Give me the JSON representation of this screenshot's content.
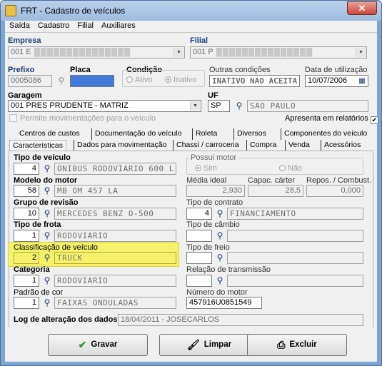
{
  "window": {
    "title": "FRT - Cadastro de veículos",
    "close": "✕"
  },
  "menu": [
    "Saída",
    "Cadastro",
    "Filial",
    "Auxiliares"
  ],
  "header": {
    "empresa_label": "Empresa",
    "empresa_value": "001 E",
    "filial_label": "Filial",
    "filial_value": "001 P",
    "prefixo_label": "Prefixo",
    "prefixo_value": "0005086",
    "placa_label": "Placa",
    "placa_value": "",
    "condicao_label": "Condição",
    "ativo": "Ativo",
    "inativo": "Inativo",
    "outras_label": "Outras condições",
    "outras_value": "INATIVO NAO ACEITA N",
    "data_label": "Data de utilização",
    "data_value": "10/07/2006",
    "garagem_label": "Garagem",
    "garagem_value": "001 PRES PRUDENTE - MATRIZ",
    "uf_label": "UF",
    "uf_value": "SP",
    "uf_city": "SAO PAULO",
    "permite_label": "Permite movimentações para o veículo",
    "apresenta_label": "Apresenta em relatórios"
  },
  "tabs_row1": [
    "Centros de custos",
    "Documentação do veículo",
    "Roleta",
    "Diversos",
    "Componentes do veículo"
  ],
  "tabs_row2": [
    "Características",
    "Dados para movimentação",
    "Chassi / carroceria",
    "Compra",
    "Venda",
    "Acessórios"
  ],
  "fields": {
    "tipo_veiculo_label": "Tipo de veículo",
    "tipo_veiculo_code": "4",
    "tipo_veiculo_desc": "ONIBUS RODOVIARIO 600 L",
    "possui_motor_label": "Possui motor",
    "sim": "Sim",
    "nao": "Não",
    "modelo_motor_label": "Modelo do motor",
    "modelo_motor_code": "58",
    "modelo_motor_desc": "MB OM 457 LA",
    "media_label": "Média ideal",
    "media_value": "2,930",
    "capac_label": "Capac. cárter",
    "capac_value": "28,5",
    "repos_label": "Repos. / Combust.",
    "repos_value": "0,000",
    "grupo_label": "Grupo de revisão",
    "grupo_code": "10",
    "grupo_desc": "MERCEDES BENZ O-500",
    "contrato_label": "Tipo de contrato",
    "contrato_code": "4",
    "contrato_desc": "FINANCIAMENTO",
    "frota_label": "Tipo de frota",
    "frota_code": "1",
    "frota_desc": "RODOVIARIO",
    "cambio_label": "Tipo de câmbio",
    "classif_label": "Classificação de veículo",
    "classif_code": "2",
    "classif_desc": "TRUCK",
    "freio_label": "Tipo de freio",
    "categoria_label": "Categoria",
    "categoria_code": "1",
    "categoria_desc": "RODOVIARIO",
    "transmissao_label": "Relação de transmissão",
    "cor_label": "Padrão de cor",
    "cor_code": "1",
    "cor_desc": "FAIXAS ONDULADAS",
    "numero_motor_label": "Número do motor",
    "numero_motor_value": "457916U0851549",
    "log_label": "Log de alteração dos dados",
    "log_value": "18/04/2011 - JOSECARLOS"
  },
  "buttons": {
    "gravar": "Gravar",
    "limpar": "Limpar",
    "excluir": "Excluir"
  },
  "icons": {
    "lookup": "binoculars-icon",
    "calendar": "calendar-icon",
    "check": "✔",
    "printer": "⎙",
    "brush": "🖌"
  }
}
